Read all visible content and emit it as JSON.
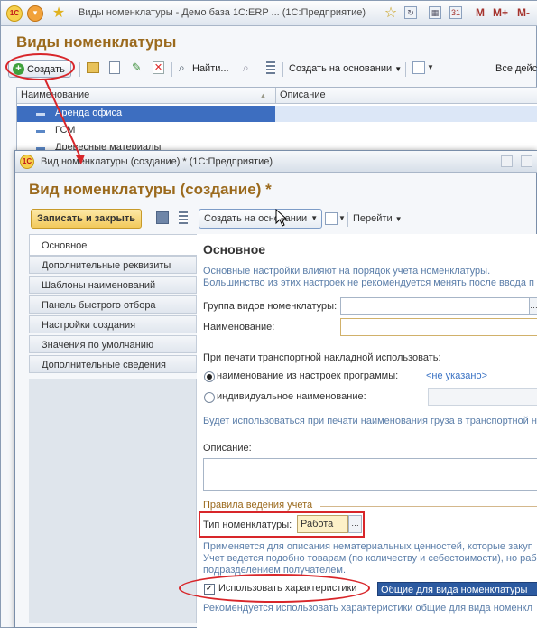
{
  "bg_window": {
    "title": "Виды номенклатуры - Демо база 1С:ERP ... (1С:Предприятие)",
    "heading": "Виды номенклатуры",
    "toolbar": {
      "create_label": "Создать",
      "find_label": "Найти...",
      "create_basis_label": "Создать на основании",
      "all_actions_label": "Все дейс"
    },
    "title_buttons": [
      "M",
      "M+",
      "M-"
    ],
    "table": {
      "columns": [
        "Наименование",
        "Описание"
      ],
      "rows": [
        "Аренда офиса",
        "ГСМ",
        "Древесные материалы"
      ]
    }
  },
  "fg_window": {
    "title": "Вид номенклатуры (создание) * (1С:Предприятие)",
    "heading": "Вид номенклатуры (создание) *",
    "toolbar": {
      "save_close_label": "Записать и закрыть",
      "create_basis_label": "Создать на основании",
      "goto_label": "Перейти"
    },
    "nav_items": [
      "Основное",
      "Дополнительные реквизиты",
      "Шаблоны наименований",
      "Панель быстрого отбора",
      "Настройки создания",
      "Значения по умолчанию",
      "Дополнительные сведения"
    ],
    "form": {
      "section_title": "Основное",
      "hint_1": "Основные настройки влияют на порядок учета номенклатуры.",
      "hint_2": "Большинство из этих настроек не рекомендуется менять после ввода п",
      "group_label": "Группа видов номенклатуры:",
      "name_label": "Наименование:",
      "print_label": "При печати транспортной накладной использовать:",
      "radio_1": "наименование из настроек программы:",
      "radio_1_link": "<не указано>",
      "radio_2": "индивидуальное наименование:",
      "print_hint": "Будет использоваться при печати наименования груза в транспортной н",
      "description_label": "Описание:",
      "accounting_group": "Правила ведения учета",
      "type_label": "Тип номенклатуры:",
      "type_value": "Работа",
      "type_hint_1": "Применяется для описания нематериальных ценностей, которые закуп",
      "type_hint_2": "Учет ведется подобно товарам (по количеству и себестоимости), но рабо",
      "type_hint_3": "подразделением получателем.",
      "characteristics_label": "Использовать характеристики",
      "characteristics_value": "Общие для вида номенклатуры",
      "characteristics_hint": "Рекомендуется использовать характеристики общие для вида номенкл"
    }
  },
  "colors": {
    "heading": "#9b6a1d",
    "annotation_red": "#d8262a",
    "selection_blue": "#2c5aa0",
    "link_blue": "#3b73c4"
  }
}
